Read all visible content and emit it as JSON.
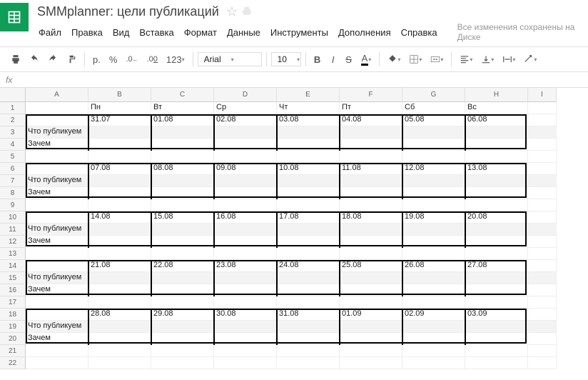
{
  "doc": {
    "title": "SMMplanner: цели публикаций"
  },
  "menu": {
    "file": "Файл",
    "edit": "Правка",
    "view": "Вид",
    "insert": "Вставка",
    "format": "Формат",
    "data": "Данные",
    "tools": "Инструменты",
    "addons": "Дополнения",
    "help": "Справка"
  },
  "save_status": "Все изменения сохранены на Диске",
  "toolbar": {
    "currency": "p.",
    "percent": "%",
    "dec_dec": ".0",
    "dec_inc": ".00",
    "numfmt": "123",
    "font": "Arial",
    "size": "10"
  },
  "fx": "fx",
  "cols": [
    "A",
    "B",
    "C",
    "D",
    "E",
    "F",
    "G",
    "H",
    "I"
  ],
  "rows": [
    "1",
    "2",
    "3",
    "4",
    "5",
    "6",
    "7",
    "8",
    "9",
    "10",
    "11",
    "12",
    "13",
    "14",
    "15",
    "16",
    "17",
    "18",
    "19",
    "20",
    "21",
    "22"
  ],
  "days": {
    "mon": "Пн",
    "tue": "Вт",
    "wed": "Ср",
    "thu": "Чт",
    "fri": "Пт",
    "sat": "Сб",
    "sun": "Вс"
  },
  "labels": {
    "what": "Что публикуем",
    "why": "Зачем"
  },
  "weeks": [
    {
      "dates": [
        "31.07",
        "01.08",
        "02.08",
        "03.08",
        "04.08",
        "05.08",
        "06.08"
      ]
    },
    {
      "dates": [
        "07.08",
        "08.08",
        "09.08",
        "10.08",
        "11.08",
        "12.08",
        "13.08"
      ]
    },
    {
      "dates": [
        "14.08",
        "15.08",
        "16.08",
        "17.08",
        "18.08",
        "19.08",
        "20.08"
      ]
    },
    {
      "dates": [
        "21.08",
        "22.08",
        "23.08",
        "24.08",
        "25.08",
        "26.08",
        "27.08"
      ]
    },
    {
      "dates": [
        "28.08",
        "29.08",
        "30.08",
        "31.08",
        "01.09",
        "02.09",
        "03.09"
      ]
    }
  ]
}
